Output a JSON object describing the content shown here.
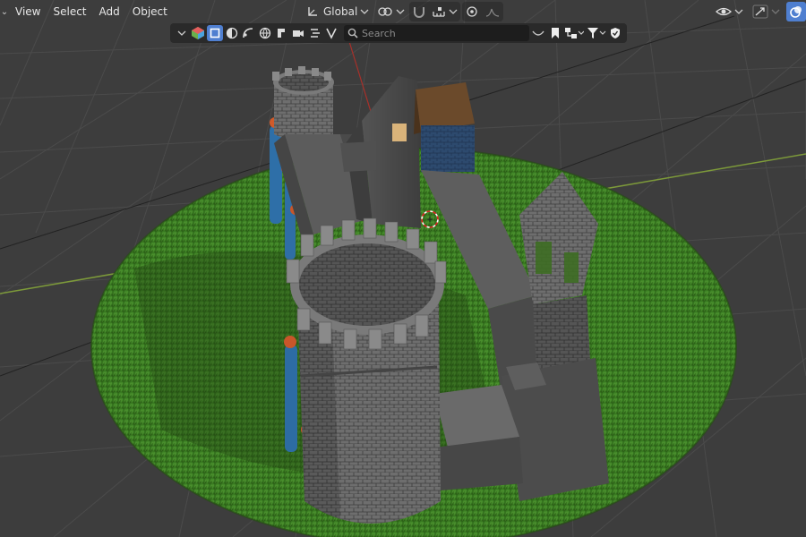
{
  "header": {
    "menus": [
      "View",
      "Select",
      "Add",
      "Object"
    ],
    "transform_orientation": "Global"
  },
  "header2": {
    "search_placeholder": "Search"
  },
  "colors": {
    "viewport_bg": "#3d3d3d",
    "grid_line": "#4a4a4a",
    "x_axis": "#c0392b",
    "y_axis": "#6aa333",
    "grass": "#3c7a22",
    "stone": "#707070",
    "accent_blue": "#4f7fd0"
  },
  "icons": {
    "orientation": "transform-orientation-icon",
    "pivot": "pivot-point-icon",
    "snap": "snap-magnet-icon",
    "proportional": "proportional-edit-icon",
    "visibility": "eye-visibility-icon",
    "gizmo": "gizmo-icon",
    "overlay": "overlay-icon",
    "search": "search-icon",
    "filter": "filter-icon"
  }
}
